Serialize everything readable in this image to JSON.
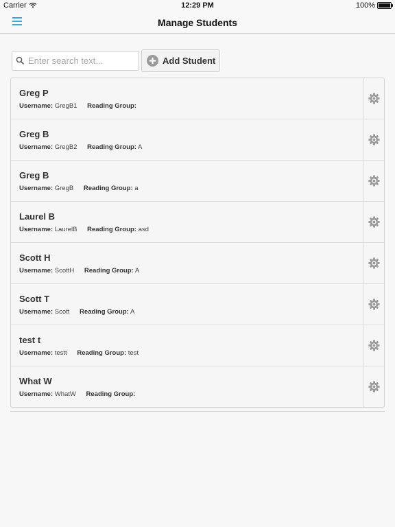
{
  "status": {
    "carrier": "Carrier",
    "time": "12:29 PM",
    "battery": "100%",
    "battery_level": 1.0
  },
  "nav": {
    "title": "Manage Students",
    "menu_icon": "hamburger-menu-icon"
  },
  "search": {
    "placeholder": "Enter search text...",
    "value": "",
    "icon": "search-icon"
  },
  "add_button": {
    "label": "Add Student",
    "icon": "plus-circle-icon"
  },
  "labels": {
    "username": "Username:",
    "reading_group": "Reading Group:"
  },
  "students": [
    {
      "name": "Greg P",
      "username": "GregB1",
      "reading_group": ""
    },
    {
      "name": "Greg B",
      "username": "GregB2",
      "reading_group": "A"
    },
    {
      "name": "Greg B",
      "username": "GregB",
      "reading_group": "a"
    },
    {
      "name": "Laurel B",
      "username": "LaurelB",
      "reading_group": "asd"
    },
    {
      "name": "Scott H",
      "username": "ScottH",
      "reading_group": "A"
    },
    {
      "name": "Scott T",
      "username": "Scott",
      "reading_group": "A"
    },
    {
      "name": "test t",
      "username": "testt",
      "reading_group": "test"
    },
    {
      "name": "What W",
      "username": "WhatW",
      "reading_group": ""
    }
  ],
  "colors": {
    "accent": "#38a9e0",
    "gear": "#9a9a9a",
    "plus": "#9a9a9a"
  }
}
